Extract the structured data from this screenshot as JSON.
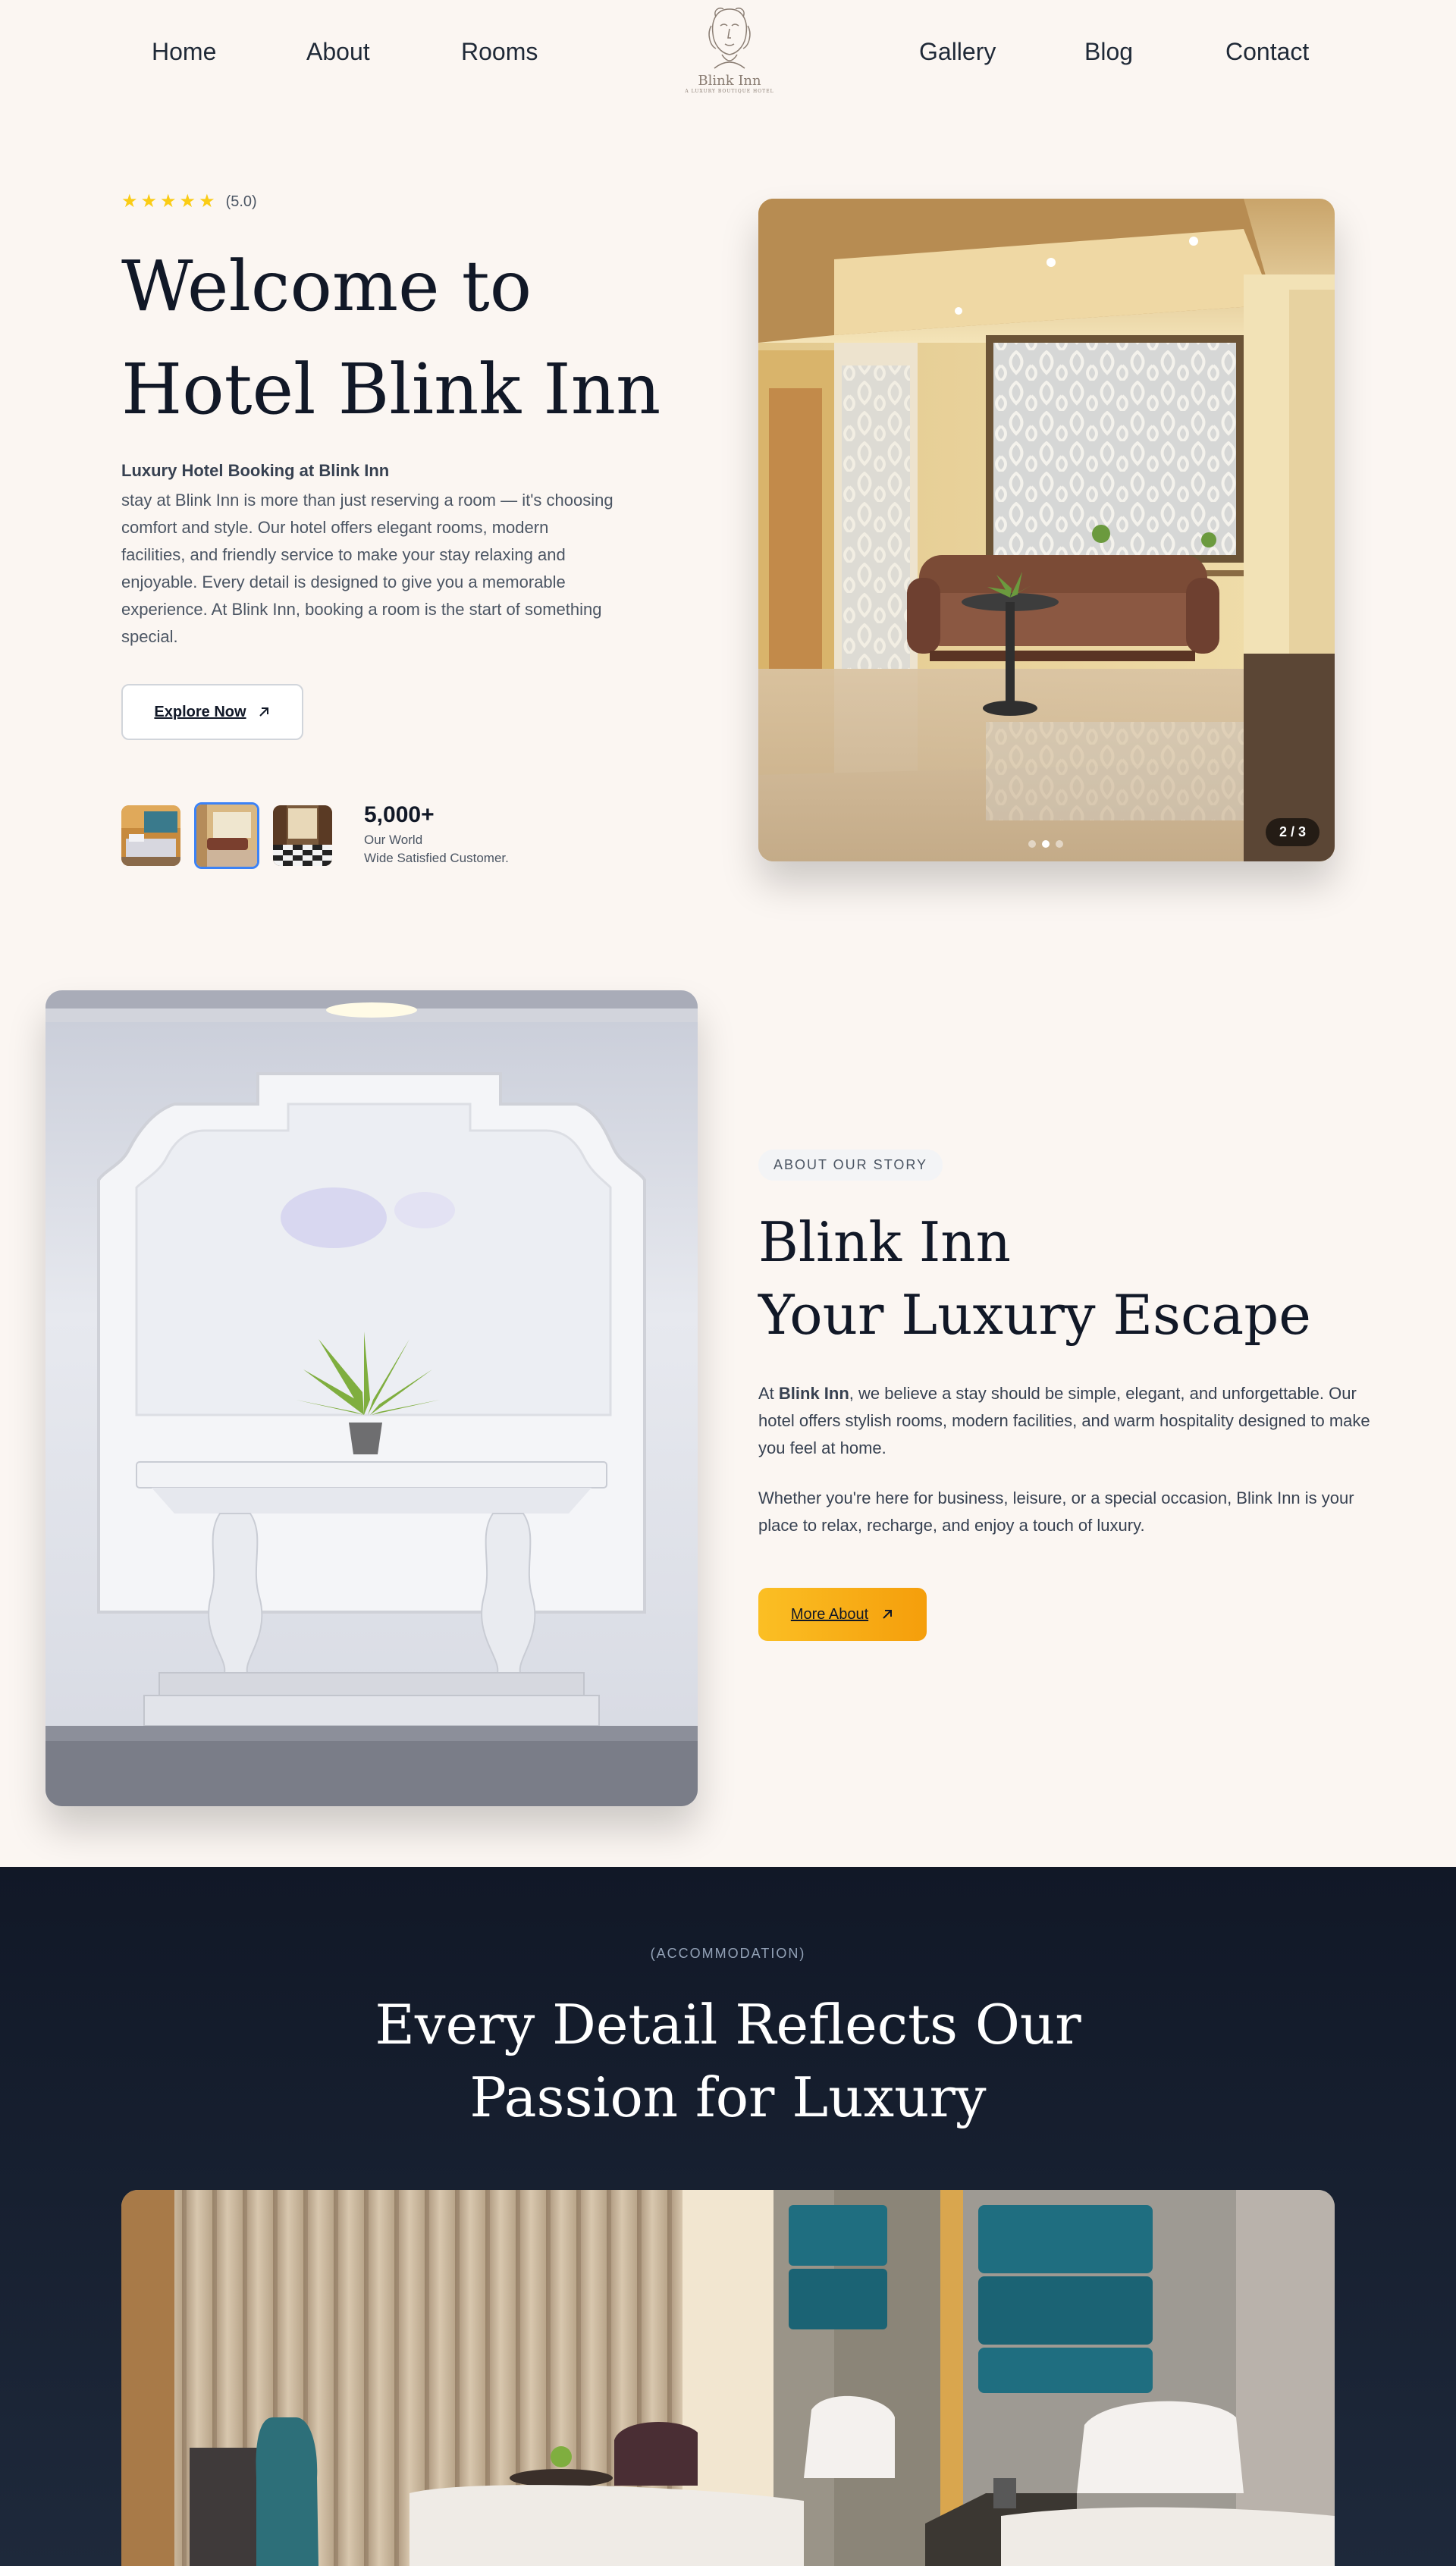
{
  "nav": {
    "left": [
      "Home",
      "About",
      "Rooms"
    ],
    "right": [
      "Gallery",
      "Blog",
      "Contact"
    ],
    "logo_name": "Blink Inn",
    "logo_tagline": "A LUXURY BOUTIQUE HOTEL"
  },
  "hero": {
    "rating_text": "(5.0)",
    "rating_stars": 5,
    "title_line1": "Welcome to",
    "title_line2": "Hotel Blink Inn",
    "subtitle": "Luxury Hotel Booking at Blink Inn",
    "description": "stay at Blink Inn is more than just reserving a room — it's choosing comfort and style. Our hotel offers elegant rooms, modern facilities, and friendly service to make your stay relaxing and enjoyable. Every detail is designed to give you a memorable experience. At Blink Inn, booking a room is the start of something special.",
    "explore_label": "Explore Now",
    "stats_number": "5,000+",
    "stats_label_line1": "Our World",
    "stats_label_line2": "Wide Satisfied Customer.",
    "slide_counter": "2 / 3"
  },
  "about": {
    "tag": "ABOUT OUR STORY",
    "title_line1": "Blink Inn",
    "title_line2": "Your Luxury Escape",
    "p1_prefix": "At ",
    "p1_brand": "Blink Inn",
    "p1_rest": ", we believe a stay should be simple, elegant, and unforgettable. Our hotel offers stylish rooms, modern facilities, and warm hospitality designed to make you feel at home.",
    "p2": "Whether you're here for business, leisure, or a special occasion, Blink Inn is your place to relax, recharge, and enjoy a touch of luxury.",
    "more_label": "More About"
  },
  "accommodation": {
    "tag": "(ACCOMMODATION)",
    "title_line1": "Every Detail Reflects Our",
    "title_line2": "Passion for Luxury"
  },
  "colors": {
    "background": "#fbf6f2",
    "accent": "#f59e0b",
    "dark_section": "#111827",
    "star": "#facc15",
    "thumb_active_border": "#3b82f6"
  },
  "icons": {
    "arrow": "arrow-up-right-icon",
    "star": "star-icon"
  }
}
